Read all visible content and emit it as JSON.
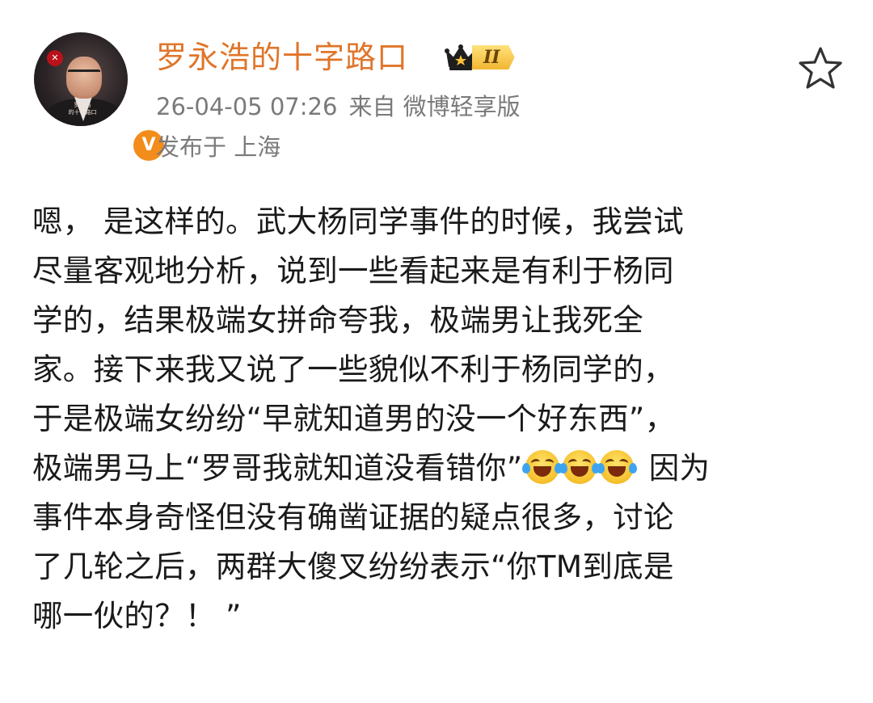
{
  "header": {
    "username": "罗永浩的十字路口",
    "member_level": "II",
    "verified_mark": "V",
    "timestamp": "26-04-05 07:26",
    "source_prefix": "来自",
    "source_app": "微博轻享版",
    "location": "发布于 上海",
    "avatar_caption_line1": "罗永浩",
    "avatar_caption_line2": "的十字路口"
  },
  "post": {
    "lines": [
      "嗯，  是这样的。武大杨同学事件的时候，我尝试",
      "尽量客观地分析，说到一些看起来是有利于杨同",
      "学的，结果极端女拼命夸我，极端男让我死全",
      "家。接下来我又说了一些貌似不利于杨同学的，",
      "于是极端女纷纷“早就知道男的没一个好东西”，"
    ],
    "line6_before_emoji": "极端男马上“罗哥我就知道没看错你”",
    "line6_after_emoji": " 因为",
    "lines_after": [
      "事件本身奇怪但没有确凿证据的疑点很多，讨论",
      "了几轮之后，两群大傻叉纷纷表示“你TM到底是",
      "哪一伙的？！  ”"
    ],
    "emoji_name": "laughing-tears-icon",
    "emoji_count": 3
  },
  "colors": {
    "username": "#e0752a",
    "meta": "#7a7a7a",
    "verified": "#f28c1a",
    "body_text": "#1a1a1a"
  },
  "icons": {
    "favorite": "star-outline-icon",
    "crown": "crown-icon"
  }
}
